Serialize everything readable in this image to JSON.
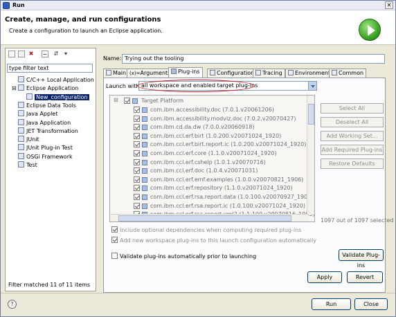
{
  "window": {
    "title": "Run",
    "close_glyph": "✕"
  },
  "header": {
    "title": "Create, manage, and run configurations",
    "description": "Create a configuration to launch an Eclipse application."
  },
  "left": {
    "toolbar_icons": [
      "new-config-icon",
      "duplicate-icon",
      "delete-icon",
      "collapse-all-icon",
      "filter-icon",
      "chevron-down-icon"
    ],
    "filter_text": "type filter text",
    "tree": [
      {
        "label": "C/C++ Local Application",
        "level": 0,
        "icon": "cpp-app-icon"
      },
      {
        "label": "Eclipse Application",
        "level": 0,
        "icon": "eclipse-app-icon",
        "expanded": true
      },
      {
        "label": "New_configuration",
        "level": 1,
        "icon": "eclipse-config-icon",
        "selected": true
      },
      {
        "label": "Eclipse Data Tools",
        "level": 0,
        "icon": "data-tools-icon"
      },
      {
        "label": "Java Applet",
        "level": 0,
        "icon": "java-applet-icon"
      },
      {
        "label": "Java Application",
        "level": 0,
        "icon": "java-app-icon"
      },
      {
        "label": "JET Transformation",
        "level": 0,
        "icon": "jet-icon"
      },
      {
        "label": "JUnit",
        "level": 0,
        "icon": "junit-icon"
      },
      {
        "label": "JUnit Plug-in Test",
        "level": 0,
        "icon": "junit-plugin-icon"
      },
      {
        "label": "OSGi Framework",
        "level": 0,
        "icon": "osgi-icon"
      },
      {
        "label": "Test",
        "level": 0,
        "icon": "test-icon"
      }
    ],
    "status": "Filter matched 11 of 11 items"
  },
  "main": {
    "name_label": "Name:",
    "name_value": "Trying out the tooling",
    "tabs": [
      {
        "label": "Main"
      },
      {
        "label": "Arguments"
      },
      {
        "label": "Plug-ins",
        "active": true
      },
      {
        "label": "Configuration"
      },
      {
        "label": "Tracing"
      },
      {
        "label": "Environment"
      },
      {
        "label": "Common"
      }
    ],
    "launch_with_label": "Launch with:",
    "launch_with_value": "all workspace and enabled target plug-ins",
    "plugins_root": "Target Platform",
    "plugins": [
      "com.ibm.accessibility.doc (7.0.1.v20061206)",
      "com.ibm.accessibility.modviz.doc (7.0.2.v20070427)",
      "com.ibm.cd.da.dw (7.0.0.v20060918)",
      "com.ibm.ccl.erf.birt (1.0.200.v20071024_1920)",
      "com.ibm.ccl.erf.birt.report.ic (1.0.200.v20071024_1920)",
      "com.ibm.ccl.erf.core (1.1.0.v20071024_1920)",
      "com.ibm.ccl.erf.cshelp (1.0.1.v20070716)",
      "com.ibm.ccl.erf.doc (1.0.4.v20071031)",
      "com.ibm.ccl.erf.emf.examples (1.0.0.v20070821_1906)",
      "com.ibm.ccl.erf.repository (1.1.0.v20071024_1920)",
      "com.ibm.ccl.erf.rsa.report.data (1.0.100.v20070927_1905)",
      "com.ibm.ccl.erf.rsa.report.ic (1.0.100.v20071024_1920)",
      "com.ibm.ccl.erf.rsa.report.uml2 (1.1.100.v20070816_1905)"
    ],
    "side_buttons": [
      "Select All",
      "Deselect All",
      "Add Working Set...",
      "Add Required Plug-ins",
      "Restore Defaults"
    ],
    "count_text": "1097 out of 1097 selected",
    "options": [
      {
        "label": "Include optional dependencies when computing required plug-ins",
        "checked": true,
        "enabled": false
      },
      {
        "label": "Add new workspace plug-ins to this launch configuration automatically",
        "checked": true,
        "enabled": false
      }
    ],
    "validate_auto_label": "Validate plug-ins automatically prior to launching",
    "validate_button": "Validate Plug-ins",
    "apply_button": "Apply",
    "revert_button": "Revert"
  },
  "footer": {
    "help_glyph": "?",
    "run_button": "Run",
    "close_button": "Close"
  },
  "colors": {
    "selection": "#0a246a",
    "highlight_oval": "#d2141a",
    "dialog_bg": "#ece9d8"
  }
}
